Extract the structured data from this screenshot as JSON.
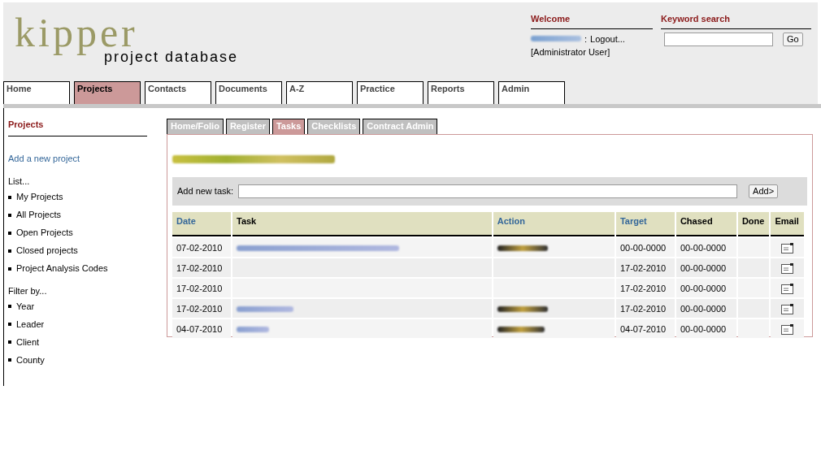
{
  "logo": {
    "name": "kipper",
    "subtitle": "project database"
  },
  "welcome": {
    "title": "Welcome",
    "user_blurred": true,
    "separator": ":",
    "logout": "Logout...",
    "role": "[Administrator User]"
  },
  "search": {
    "title": "Keyword search",
    "button": "Go"
  },
  "nav": [
    {
      "label": "Home",
      "selected": false
    },
    {
      "label": "Projects",
      "selected": true
    },
    {
      "label": "Contacts",
      "selected": false
    },
    {
      "label": "Documents",
      "selected": false
    },
    {
      "label": "A-Z",
      "selected": false
    },
    {
      "label": "Practice",
      "selected": false
    },
    {
      "label": "Reports",
      "selected": false
    },
    {
      "label": "Admin",
      "selected": false
    }
  ],
  "sidebar": {
    "title": "Projects",
    "add_link": "Add a new project",
    "sections": [
      {
        "heading": "List...",
        "items": [
          "My Projects",
          "All Projects",
          "Open Projects",
          "Closed projects",
          "Project Analysis Codes"
        ]
      },
      {
        "heading": "Filter by...",
        "items": [
          "Year",
          "Leader",
          "Client",
          "County"
        ]
      }
    ]
  },
  "subtabs": [
    {
      "label": "Home/Folio",
      "selected": false
    },
    {
      "label": "Register",
      "selected": false
    },
    {
      "label": "Tasks",
      "selected": true
    },
    {
      "label": "Checklists",
      "selected": false
    },
    {
      "label": "Contract Admin",
      "selected": false
    }
  ],
  "project_title_blurred": true,
  "new_task": {
    "label": "Add new task:",
    "button": "Add>"
  },
  "table": {
    "columns": [
      {
        "label": "Date",
        "sortable": true
      },
      {
        "label": "Task",
        "sortable": false
      },
      {
        "label": "Action",
        "sortable": true
      },
      {
        "label": "Target",
        "sortable": true
      },
      {
        "label": "Chased",
        "sortable": false
      },
      {
        "label": "Done",
        "sortable": false
      },
      {
        "label": "Email",
        "sortable": false
      }
    ],
    "rows": [
      {
        "date": "07-02-2010",
        "task_blurred": true,
        "action_blurred": true,
        "target": "00-00-0000",
        "chased": "00-00-0000"
      },
      {
        "date": "17-02-2010",
        "task_blurred": false,
        "action_blurred": false,
        "target": "17-02-2010",
        "chased": "00-00-0000"
      },
      {
        "date": "17-02-2010",
        "task_blurred": false,
        "action_blurred": false,
        "target": "17-02-2010",
        "chased": "00-00-0000"
      },
      {
        "date": "17-02-2010",
        "task_blurred": true,
        "action_blurred": true,
        "target": "17-02-2010",
        "chased": "00-00-0000"
      },
      {
        "date": "04-07-2010",
        "task_blurred": true,
        "action_blurred": true,
        "target": "04-07-2010",
        "chased": "00-00-0000"
      }
    ]
  }
}
